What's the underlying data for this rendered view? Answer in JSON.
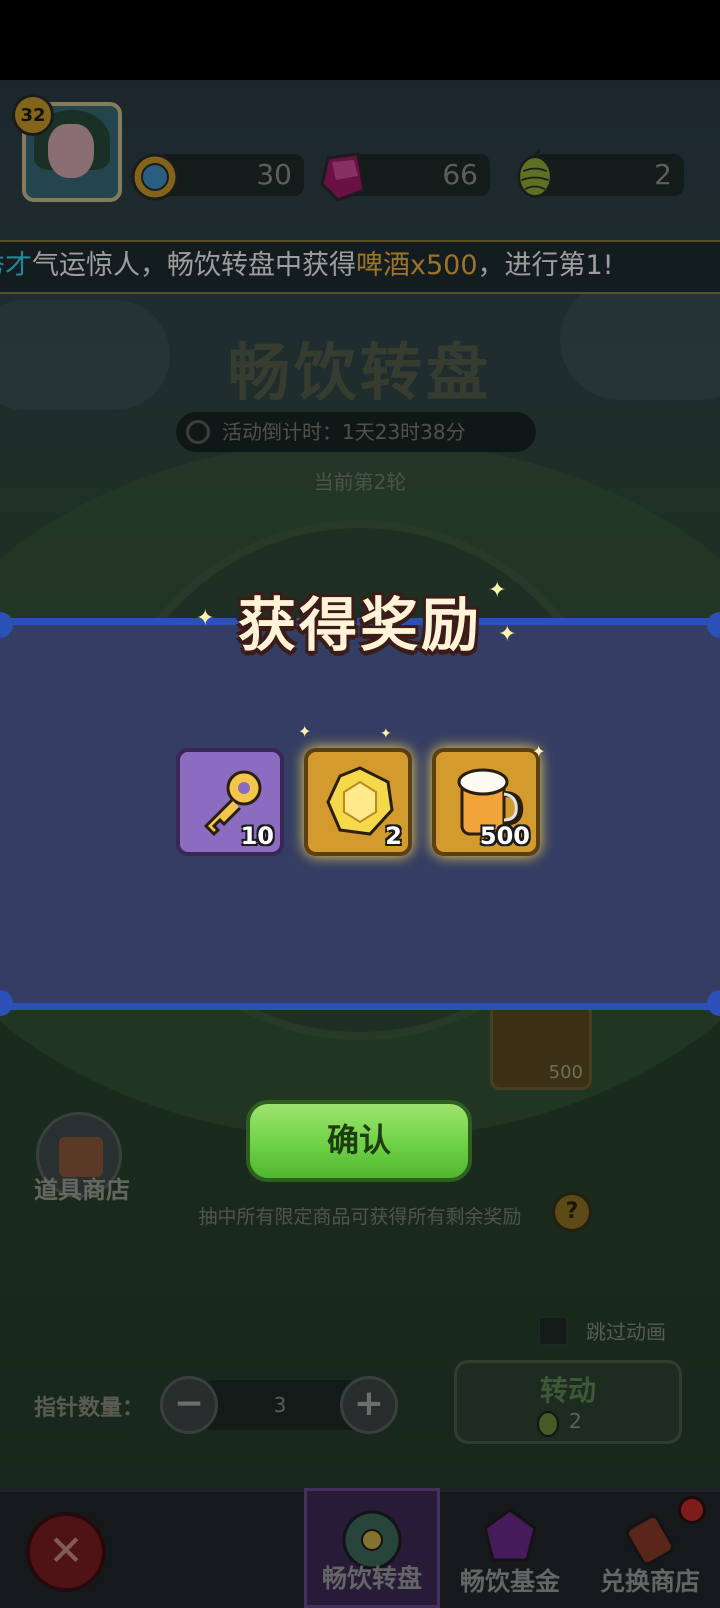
{
  "colors": {
    "accent_cyan": "#37d1e4",
    "accent_orange": "#f0b13e",
    "band_blue": "#2b50b8",
    "confirm_green": "#6bcf43"
  },
  "player": {
    "level": "32"
  },
  "resources": [
    {
      "icon": "gold-coin-icon",
      "value": "30"
    },
    {
      "icon": "gem-icon",
      "value": "66"
    },
    {
      "icon": "hop-icon",
      "value": "2"
    }
  ],
  "ticker": {
    "part1": "秀才",
    "part2": "气运惊人，畅饮转盘中获得",
    "part3": "啤酒x500",
    "part4": "，进行第1!"
  },
  "wheel": {
    "title": "畅饮转盘",
    "countdown": "活动倒计时：1天23时38分",
    "round": "当前第2轮",
    "bottom_item_count": "500"
  },
  "reward": {
    "title": "获得奖励",
    "items": [
      {
        "icon": "key-icon",
        "count": "10"
      },
      {
        "icon": "gem-coin-icon",
        "count": "2"
      },
      {
        "icon": "beer-mug-icon",
        "count": "500"
      }
    ]
  },
  "confirm_label": "确认",
  "shop_label": "道具商店",
  "hint": "抽中所有限定商品可获得所有剩余奖励",
  "help": "?",
  "skip_label": "跳过动画",
  "pointer": {
    "label": "指针数量：",
    "value": "3",
    "minus": "−",
    "plus": "+"
  },
  "spin": {
    "label": "转动",
    "cost": "2"
  },
  "close": "✕",
  "nav": [
    {
      "label": "畅饮转盘",
      "icon": "wheel-icon",
      "active": true
    },
    {
      "label": "畅饮基金",
      "icon": "fund-gem-icon",
      "active": false
    },
    {
      "label": "兑换商店",
      "icon": "exchange-shop-icon",
      "active": false
    }
  ]
}
